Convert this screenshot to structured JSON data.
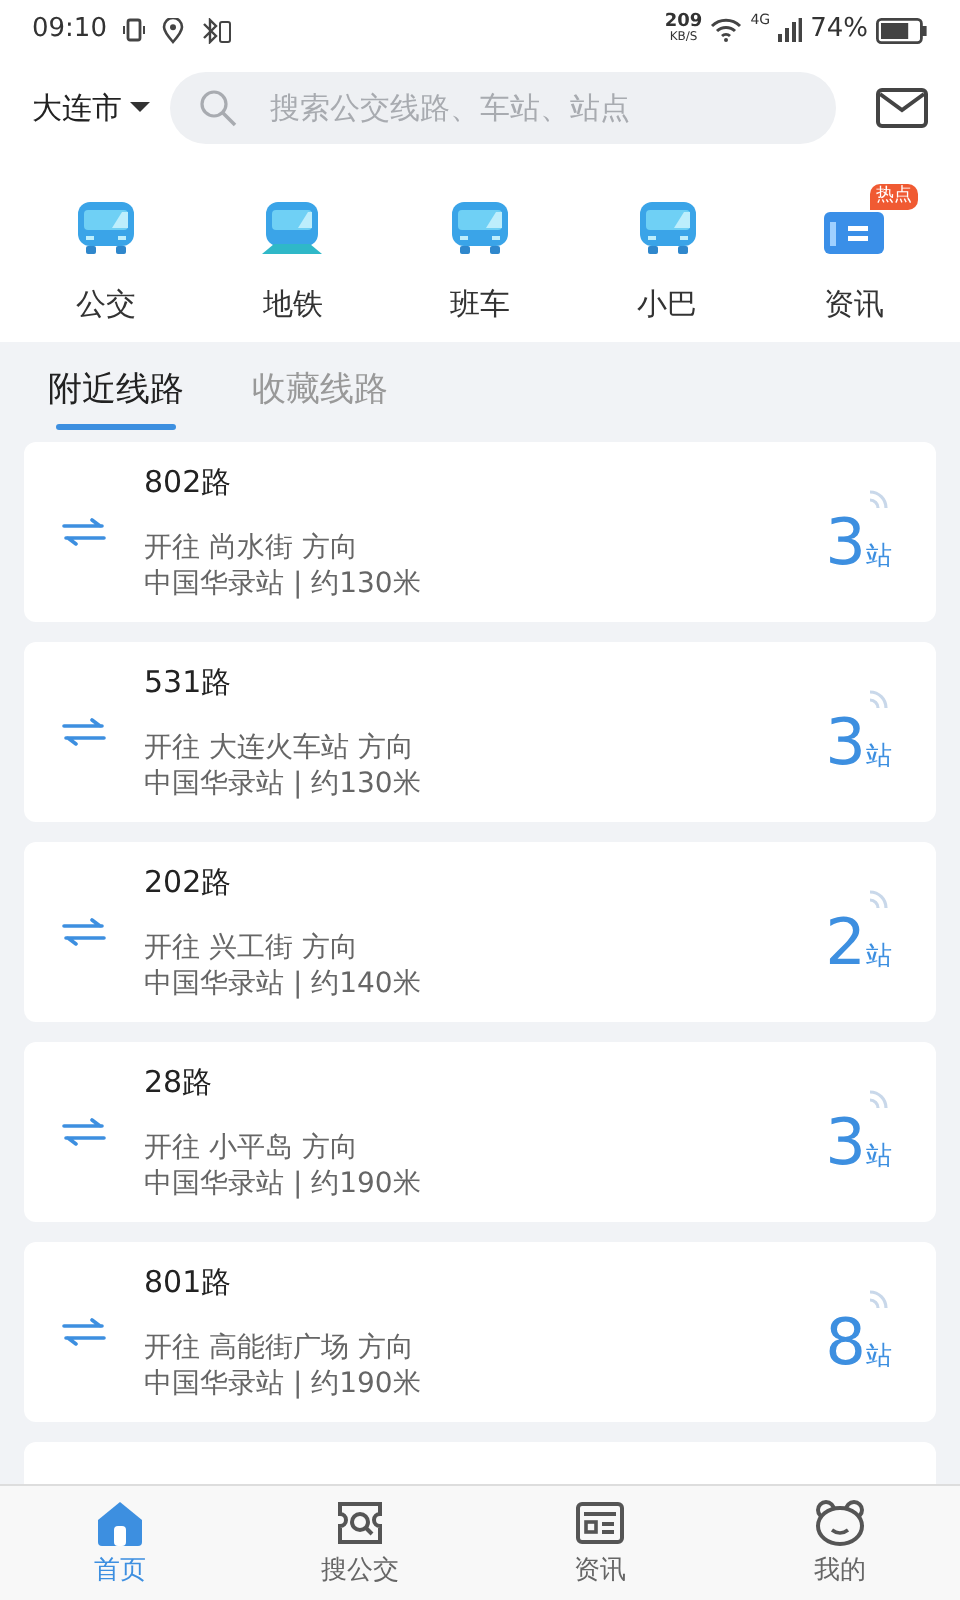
{
  "status_bar": {
    "time": "09:10",
    "speed": "209",
    "speed_unit": "KB/S",
    "network": "4G",
    "battery": "74%"
  },
  "header": {
    "city": "大连市",
    "search": {
      "placeholder": "搜索公交线路、车站、站点"
    }
  },
  "categories": [
    {
      "label": "公交",
      "kind": "bus"
    },
    {
      "label": "地铁",
      "kind": "metro"
    },
    {
      "label": "班车",
      "kind": "bus"
    },
    {
      "label": "小巴",
      "kind": "bus"
    },
    {
      "label": "资讯",
      "kind": "news",
      "badge": "热点"
    }
  ],
  "tabs": [
    {
      "label": "附近线路",
      "selected": true
    },
    {
      "label": "收藏线路",
      "selected": false
    }
  ],
  "routes": [
    {
      "name": "802路",
      "direction": "开往 尚水街 方向",
      "station": "中国华录站 | 约130米",
      "count": "3",
      "unit": "站"
    },
    {
      "name": "531路",
      "direction": "开往 大连火车站 方向",
      "station": "中国华录站 | 约130米",
      "count": "3",
      "unit": "站"
    },
    {
      "name": "202路",
      "direction": "开往 兴工街 方向",
      "station": "中国华录站 | 约140米",
      "count": "2",
      "unit": "站"
    },
    {
      "name": "28路",
      "direction": "开往 小平岛 方向",
      "station": "中国华录站 | 约190米",
      "count": "3",
      "unit": "站"
    },
    {
      "name": "801路",
      "direction": "开往 高能街广场 方向",
      "station": "中国华录站 | 约190米",
      "count": "8",
      "unit": "站"
    }
  ],
  "bottom_nav": [
    {
      "label": "首页",
      "kind": "home",
      "selected": true
    },
    {
      "label": "搜公交",
      "kind": "search",
      "selected": false
    },
    {
      "label": "资讯",
      "kind": "news",
      "selected": false
    },
    {
      "label": "我的",
      "kind": "me",
      "selected": false
    }
  ]
}
